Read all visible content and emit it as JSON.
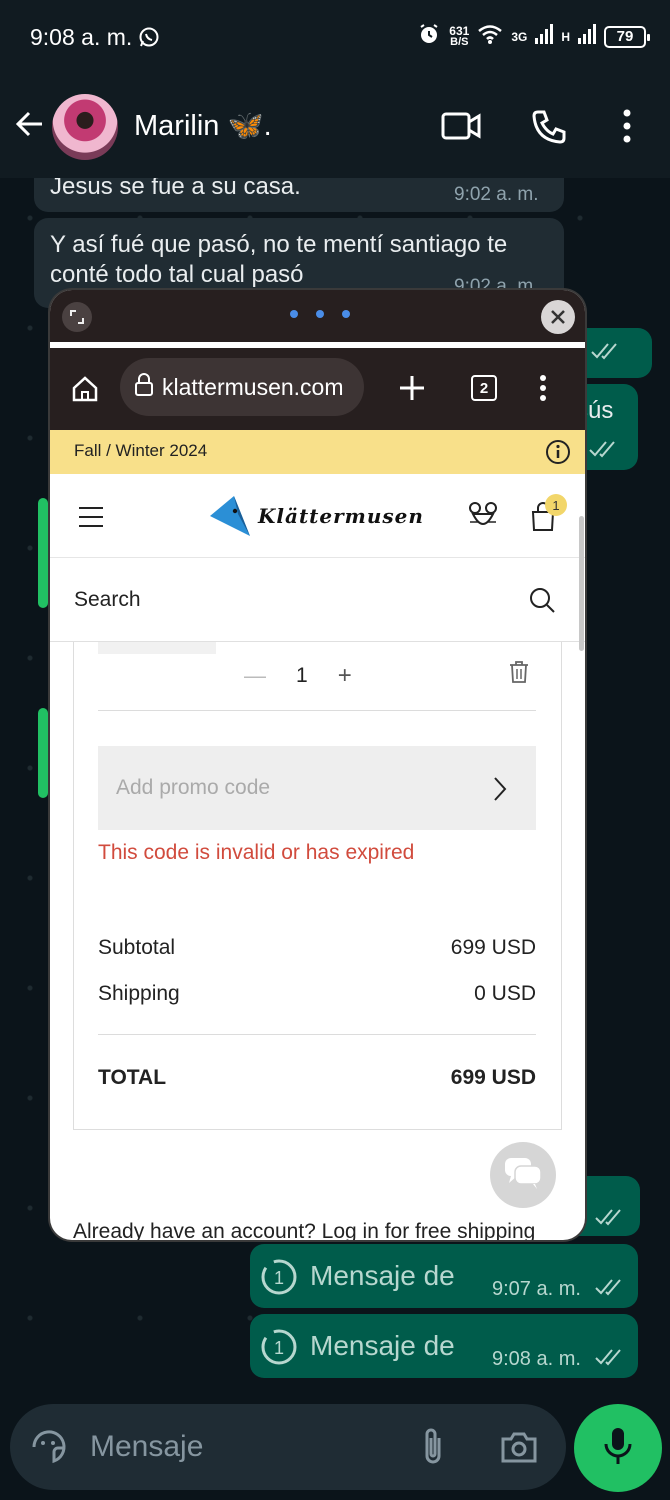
{
  "status_bar": {
    "time": "9:08 a. m.",
    "speed_value": "631",
    "speed_unit": "B/S",
    "network_1": "3G",
    "network_2": "H",
    "battery": "79"
  },
  "chat_header": {
    "contact_name": "Marilin 🦋."
  },
  "messages": [
    {
      "text": "Jesus se fue a su casa.",
      "time": "9:02 a. m."
    },
    {
      "text": "Y así fué que pasó, no te mentí santiago te conté todo tal cual pasó",
      "time": "9:02 a. m."
    },
    {
      "text": "sús"
    }
  ],
  "outgoing": [
    {
      "text": "Mensaje de",
      "time": "9:07 a. m."
    },
    {
      "text": "Mensaje de",
      "time": "9:08 a. m."
    }
  ],
  "browser": {
    "url": "klattermusen.com",
    "tab_count": "2"
  },
  "shop": {
    "banner": "Fall / Winter 2024",
    "logo": "Klättermusen",
    "cart_count": "1",
    "search_label": "Search",
    "quantity": "1",
    "promo_placeholder": "Add promo code",
    "promo_error": "This code is invalid or has expired",
    "subtotal_label": "Subtotal",
    "subtotal_value": "699 USD",
    "shipping_label": "Shipping",
    "shipping_value": "0 USD",
    "total_label": "TOTAL",
    "total_value": "699 USD",
    "account_text": "Already have an account? Log in for free shipping"
  },
  "composer": {
    "placeholder": "Mensaje"
  },
  "colors": {
    "wa_green": "#21c063",
    "outgoing_bubble": "#005c4b",
    "incoming_bubble": "#202c33",
    "banner_yellow": "#f8e08a",
    "error_red": "#d14b3d"
  }
}
